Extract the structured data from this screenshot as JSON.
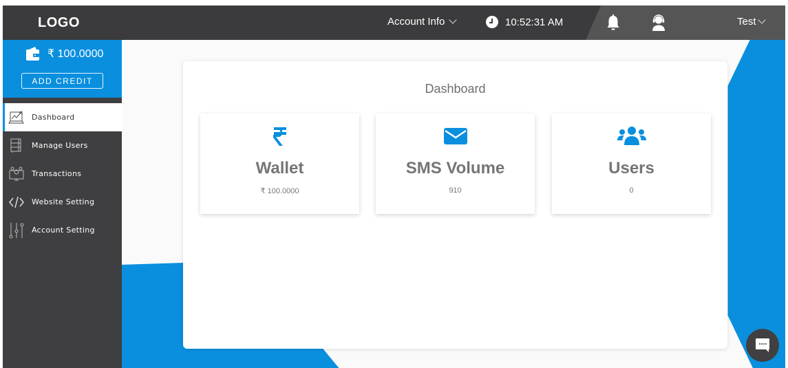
{
  "header": {
    "logo": "LOGO",
    "account_info_label": "Account Info",
    "time": "10:52:31 AM",
    "user_label": "Test",
    "icons": [
      "clock-icon",
      "bell-icon",
      "support-agent-icon",
      "chevron-down-icon"
    ]
  },
  "sidebar": {
    "wallet_balance": "₹ 100.0000",
    "add_credit_label": "ADD CREDIT",
    "items": [
      {
        "label": "Dashboard",
        "icon": "laptop-chart-icon",
        "active": true
      },
      {
        "label": "Manage Users",
        "icon": "cabinet-icon",
        "active": false
      },
      {
        "label": "Transactions",
        "icon": "monitor-coins-icon",
        "active": false
      },
      {
        "label": "Website Setting",
        "icon": "code-icon",
        "active": false
      },
      {
        "label": "Account Setting",
        "icon": "sliders-icon",
        "active": false
      }
    ]
  },
  "main": {
    "title": "Dashboard",
    "cards": [
      {
        "title": "Wallet",
        "value": "₹ 100.0000",
        "icon": "rupee-icon"
      },
      {
        "title": "SMS Volume",
        "value": "910",
        "icon": "envelope-icon"
      },
      {
        "title": "Users",
        "value": "0",
        "icon": "users-icon"
      }
    ]
  },
  "colors": {
    "accent": "#0a8fdf",
    "header_bg": "#3b3b3d",
    "sidebar_bg": "#3f3f41"
  }
}
